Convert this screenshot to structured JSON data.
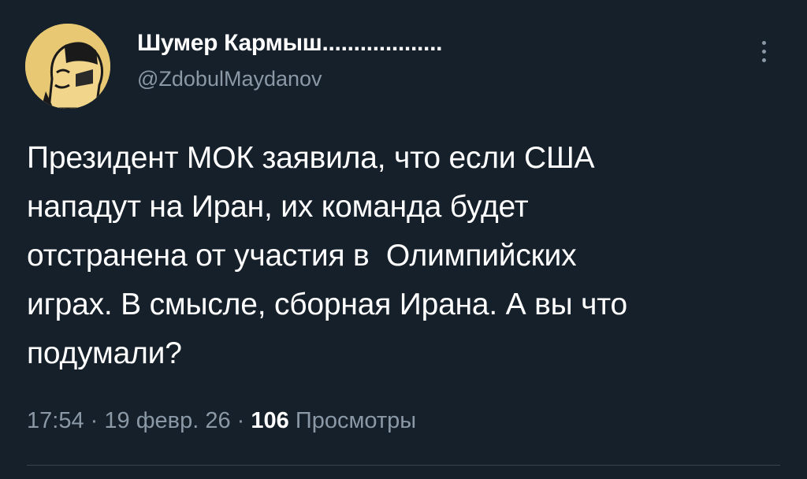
{
  "author": {
    "display_name": "Шумер Кармыш...................",
    "handle": "@ZdobulMaydanov",
    "avatar_icon": "avatar-illustration-icon"
  },
  "tweet": {
    "text_lines": [
      "Президент МОК заявила, что если США",
      "нападут на Иран, их команда будет",
      "отстранена от участия в  Олимпийских",
      "играх. В смысле, сборная Ирана. А вы что",
      "подумали?"
    ],
    "time": "17:54",
    "separator": "·",
    "date": "19 февр. 26",
    "views_count": "106",
    "views_label": "Просмотры"
  },
  "menu_icon": "more-vertical-icon",
  "colors": {
    "background": "#15202b",
    "text": "#ffffff",
    "secondary": "#8b98a5",
    "avatar": "#e8c873"
  }
}
